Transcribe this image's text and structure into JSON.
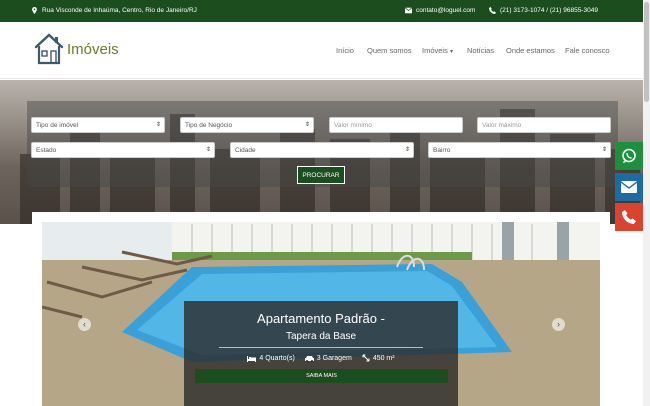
{
  "topbar": {
    "address": "Rua Visconde de Inhaúma, Centro, Rio de Janeiro/RJ",
    "email": "contato@loguel.com",
    "phones": "(21) 3173-1074 / (21) 96855-3049"
  },
  "logo": {
    "text": "Imóveis"
  },
  "nav": {
    "items": [
      "Início",
      "Quem somos",
      "Imóveis",
      "Notícias",
      "Onde estamos",
      "Fale conosco"
    ]
  },
  "search": {
    "tipo_imovel": "Tipo de imóvel",
    "tipo_negocio": "Tipo de Negócio",
    "valor_minimo_placeholder": "Valor mínimo",
    "valor_maximo_placeholder": "Valor máximo",
    "estado": "Estado",
    "cidade": "Cidade",
    "bairro": "Bairro",
    "button": "PROCURAR"
  },
  "slide": {
    "title": "Apartamento Padrão -",
    "subtitle": "Tapera da Base",
    "quartos": "4 Quarto(s)",
    "garagem": "3 Garagem",
    "area": "450 m²",
    "button": "SAIBA MAIS"
  },
  "colors": {
    "brand_green": "#1b4d1f",
    "whatsapp": "#1e8f3c",
    "email": "#1d6ba0",
    "phone": "#d9432f",
    "logo_text": "#6f7b2a"
  },
  "icons": [
    "map-marker-icon",
    "envelope-icon",
    "phone-icon",
    "house-logo-icon",
    "whatsapp-icon",
    "bed-icon",
    "car-icon",
    "area-icon",
    "chevron-left-icon",
    "chevron-right-icon"
  ]
}
